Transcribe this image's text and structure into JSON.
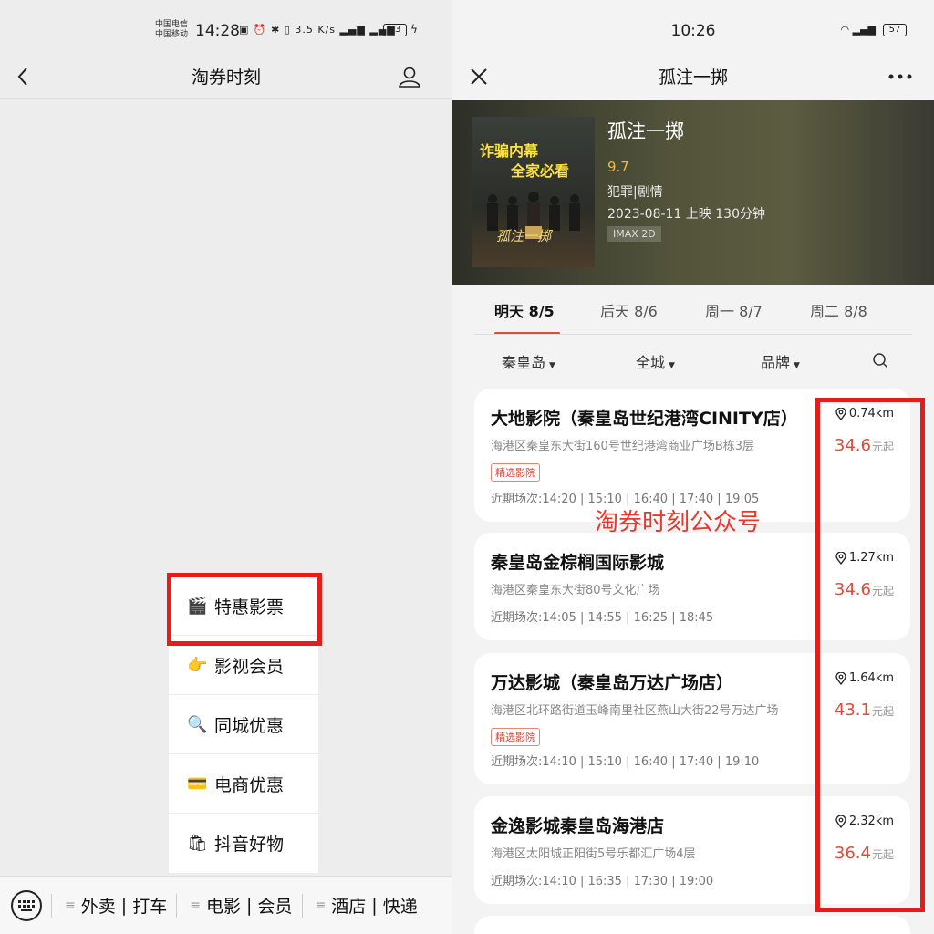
{
  "left": {
    "status": {
      "carrier1": "中国电信",
      "carrier2": "中国移动",
      "time": "14:28",
      "speed": "3.5 K/s",
      "battery": "53"
    },
    "nav": {
      "title": "淘券时刻"
    },
    "menu": [
      {
        "icon": "🎬",
        "label": "特惠影票"
      },
      {
        "icon": "👉",
        "label": "影视会员"
      },
      {
        "icon": "🔍",
        "label": "同城优惠"
      },
      {
        "icon": "💳",
        "label": "电商优惠"
      },
      {
        "icon": "🛍",
        "label": "抖音好物"
      }
    ],
    "bottom": [
      {
        "a": "外卖",
        "b": "打车"
      },
      {
        "a": "电影",
        "b": "会员"
      },
      {
        "a": "酒店",
        "b": "快递"
      }
    ]
  },
  "right": {
    "status": {
      "time": "10:26",
      "battery": "57"
    },
    "nav": {
      "title": "孤注一掷"
    },
    "movie": {
      "title": "孤注一掷",
      "score": "9.7",
      "genre": "犯罪|剧情",
      "release": "2023-08-11 上映 130分钟",
      "format": "IMAX 2D",
      "poster_line1": "诈骗内幕",
      "poster_line2": "全家必看"
    },
    "date_tabs": [
      "明天 8/5",
      "后天 8/6",
      "周一 8/7",
      "周二 8/8"
    ],
    "filters": [
      "秦皇岛",
      "全城",
      "品牌"
    ],
    "watermark": "淘券时刻公众号",
    "cinemas": [
      {
        "name": "大地影院（秦皇岛世纪港湾CINITY店）",
        "address": "海港区秦皇东大街160号世纪港湾商业广场B栋3层",
        "tag": "精选影院",
        "showtimes": "近期场次:14:20 | 15:10 | 16:40 | 17:40 | 19:05",
        "distance": "0.74km",
        "price": "34.6",
        "price_suffix": "元起"
      },
      {
        "name": "秦皇岛金棕榈国际影城",
        "address": "海港区秦皇东大街80号文化广场",
        "tag": "",
        "showtimes": "近期场次:14:05 | 14:55 | 16:25 | 18:45",
        "distance": "1.27km",
        "price": "34.6",
        "price_suffix": "元起"
      },
      {
        "name": "万达影城（秦皇岛万达广场店）",
        "address": "海港区北环路街道玉峰南里社区燕山大街22号万达广场",
        "tag": "精选影院",
        "showtimes": "近期场次:14:10 | 15:10 | 16:40 | 17:40 | 19:10",
        "distance": "1.64km",
        "price": "43.1",
        "price_suffix": "元起"
      },
      {
        "name": "金逸影城秦皇岛海港店",
        "address": "海港区太阳城正阳街5号乐都汇广场4层",
        "tag": "",
        "showtimes": "近期场次:14:10 | 16:35 | 17:30 | 19:00",
        "distance": "2.32km",
        "price": "36.4",
        "price_suffix": "元起"
      }
    ]
  },
  "colors": {
    "accent_red": "#e04a3a",
    "highlight_red": "#e51c1c",
    "score_gold": "#f1b83d"
  }
}
